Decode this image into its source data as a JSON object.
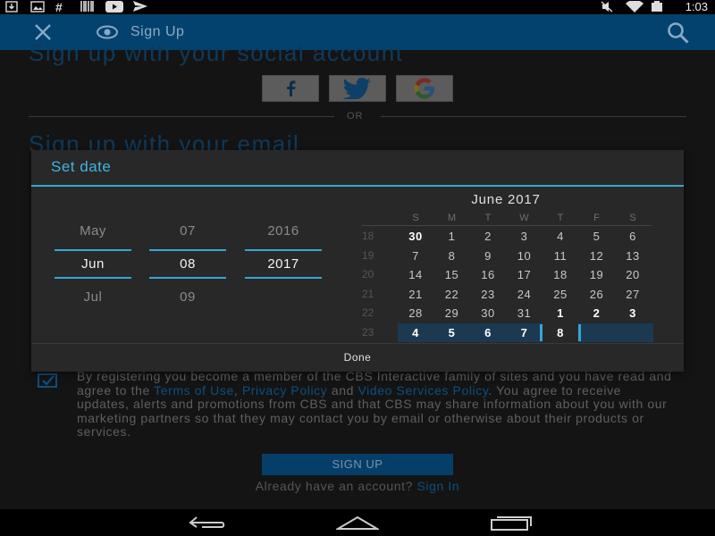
{
  "status_bar": {
    "time": "1:03",
    "icons": [
      "download-icon",
      "image-icon",
      "hashtag-icon",
      "barcode-icon",
      "youtube-icon",
      "airplane-icon",
      "mute-icon",
      "wifi-icon",
      "battery-icon"
    ]
  },
  "app_bar": {
    "title": "Sign Up",
    "icons": [
      "close-icon",
      "eye-icon",
      "search-icon"
    ],
    "color": "#03426e"
  },
  "page": {
    "social_heading": "Sign up with your social account",
    "social_buttons": [
      "f",
      "twitter",
      "G"
    ],
    "or_text": "OR",
    "email_heading": "Sign up with your email",
    "legal_text_1": "By registering you become a member of the CBS Interactive family of sites and you have read and agree to the ",
    "terms_link": "Terms of Use",
    "legal_text_2": ", ",
    "privacy_link": "Privacy Policy",
    "legal_text_3": " and ",
    "video_link": "Video Services Policy",
    "legal_text_4": ". You agree to receive updates, alerts and promotions from CBS and that CBS may share information about you with our marketing partners so that they may contact you by email or otherwise about their products or services.",
    "signup_button": "SIGN UP",
    "already_text": "Already have an account? ",
    "signin_link": "Sign In"
  },
  "dialog": {
    "title": "Set date",
    "accent": "#33a6d6",
    "spinners": {
      "month": {
        "prev": "May",
        "current": "Jun",
        "next": "Jul"
      },
      "day": {
        "prev": "07",
        "current": "08",
        "next": "09"
      },
      "year": {
        "prev": "2016",
        "current": "2017",
        "next": ""
      }
    },
    "calendar": {
      "month_label": "June 2017",
      "weekdays": [
        "S",
        "M",
        "T",
        "W",
        "T",
        "F",
        "S"
      ],
      "weeks": [
        {
          "num": "18",
          "days": [
            "30",
            "1",
            "2",
            "3",
            "4",
            "5",
            "6"
          ]
        },
        {
          "num": "19",
          "days": [
            "7",
            "8",
            "9",
            "10",
            "11",
            "12",
            "13"
          ]
        },
        {
          "num": "20",
          "days": [
            "14",
            "15",
            "16",
            "17",
            "18",
            "19",
            "20"
          ]
        },
        {
          "num": "21",
          "days": [
            "21",
            "22",
            "23",
            "24",
            "25",
            "26",
            "27"
          ]
        },
        {
          "num": "22",
          "days": [
            "28",
            "29",
            "30",
            "31",
            "1",
            "2",
            "3"
          ]
        },
        {
          "num": "23",
          "days": [
            "4",
            "5",
            "6",
            "7",
            "8",
            "",
            ""
          ]
        }
      ],
      "selected_day": "8"
    },
    "done_label": "Done"
  },
  "nav_bar": {
    "icons": [
      "back-icon",
      "home-icon",
      "recents-icon"
    ]
  }
}
